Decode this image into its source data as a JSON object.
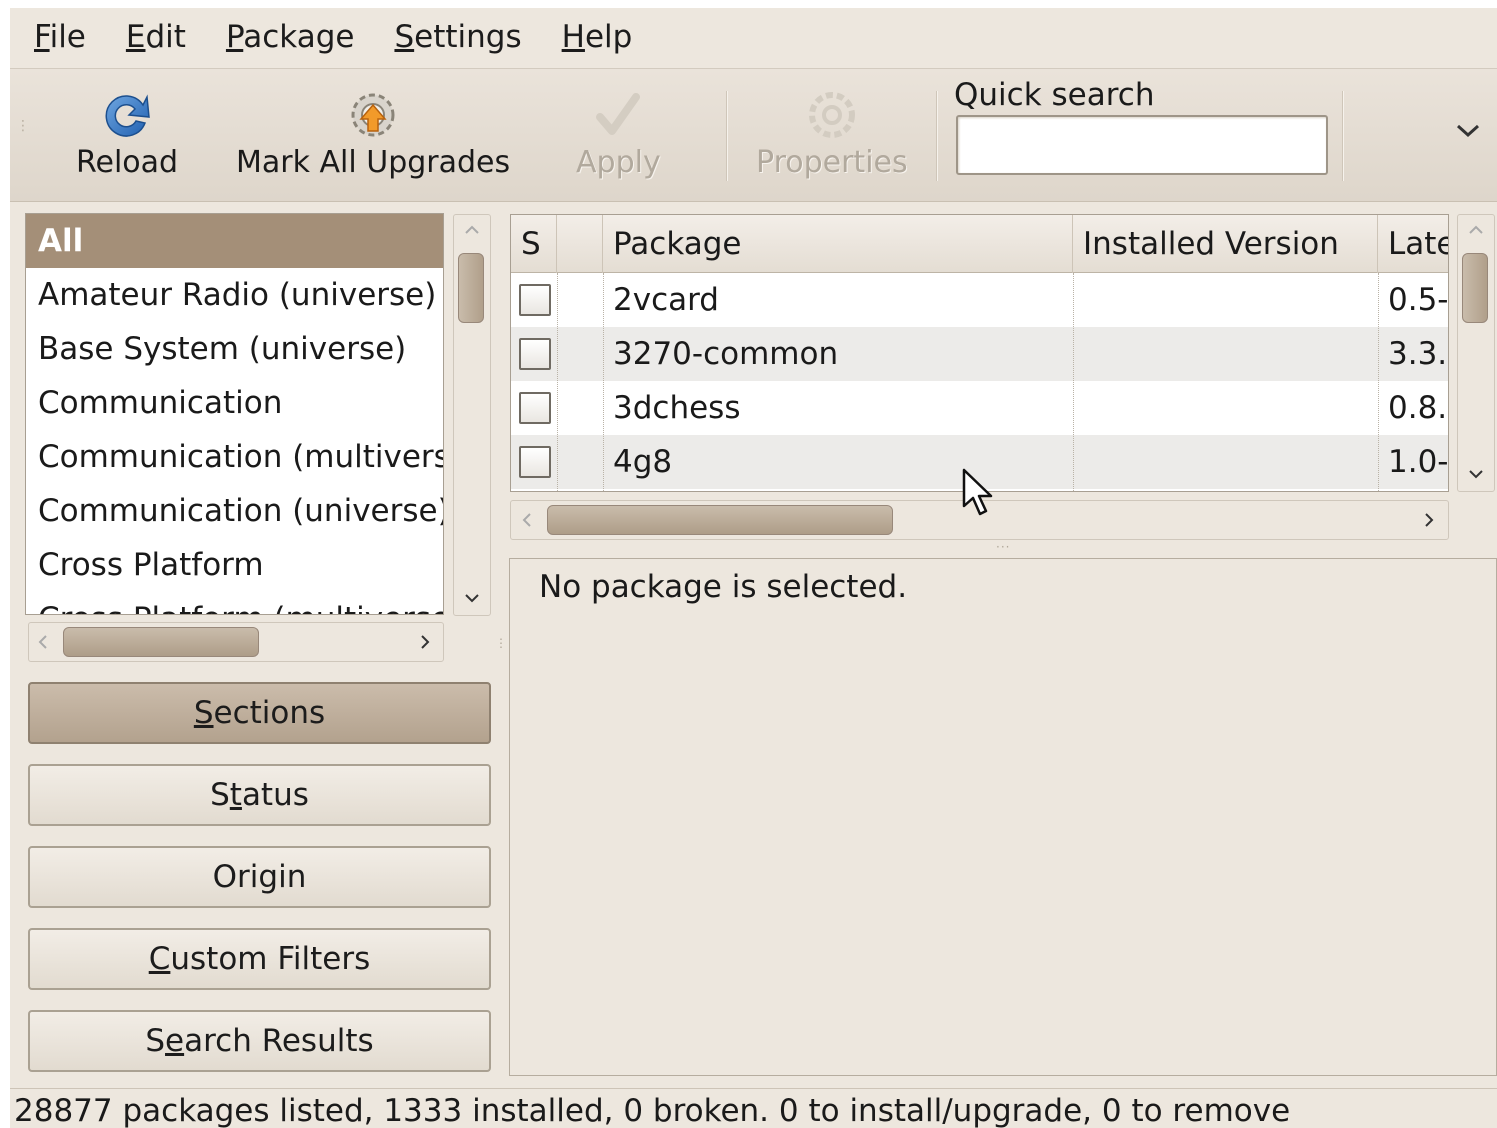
{
  "menubar": {
    "items": [
      {
        "underline": "F",
        "rest": "ile"
      },
      {
        "underline": "E",
        "rest": "dit"
      },
      {
        "underline": "P",
        "rest": "ackage"
      },
      {
        "underline": "S",
        "rest": "ettings"
      },
      {
        "underline": "H",
        "rest": "elp"
      }
    ]
  },
  "toolbar": {
    "reload_label": "Reload",
    "mark_all_label": "Mark All Upgrades",
    "apply_label": "Apply",
    "properties_label": "Properties",
    "quick_search_label": "Quick search",
    "quick_search_value": ""
  },
  "sections": {
    "items": [
      "All",
      "Amateur Radio (universe)",
      "Base System (universe)",
      "Communication",
      "Communication (multivers",
      "Communication (universe)",
      "Cross Platform",
      "Cross Platform (multiverse)"
    ],
    "selected": "All"
  },
  "filters": {
    "sections": {
      "pre": "",
      "u": "S",
      "post": "ections"
    },
    "status": {
      "pre": "S",
      "u": "t",
      "post": "atus"
    },
    "origin": {
      "pre": "Origin",
      "u": "",
      "post": ""
    },
    "custom": {
      "pre": "",
      "u": "C",
      "post": "ustom Filters"
    },
    "search": {
      "pre": "S",
      "u": "e",
      "post": "arch Results"
    }
  },
  "package_table": {
    "columns": [
      "S",
      "Package",
      "Installed Version",
      "Late"
    ],
    "rows": [
      {
        "name": "2vcard",
        "installed": "",
        "latest": "0.5-"
      },
      {
        "name": "3270-common",
        "installed": "",
        "latest": "3.3."
      },
      {
        "name": "3dchess",
        "installed": "",
        "latest": "0.8."
      },
      {
        "name": "4g8",
        "installed": "",
        "latest": "1.0-"
      }
    ]
  },
  "details": {
    "text": "No package is selected."
  },
  "status": {
    "text": "28877 packages listed, 1333 installed, 0 broken. 0 to install/upgrade, 0 to remove"
  },
  "colors": {
    "window_bg": "#ede7de",
    "selection": "#a48f78",
    "scroll_thumb": "#b09f8a"
  },
  "icons": [
    "reload-icon",
    "mark-upgrades-icon",
    "apply-icon",
    "properties-icon",
    "chevron-down-icon",
    "mouse-cursor-icon"
  ]
}
